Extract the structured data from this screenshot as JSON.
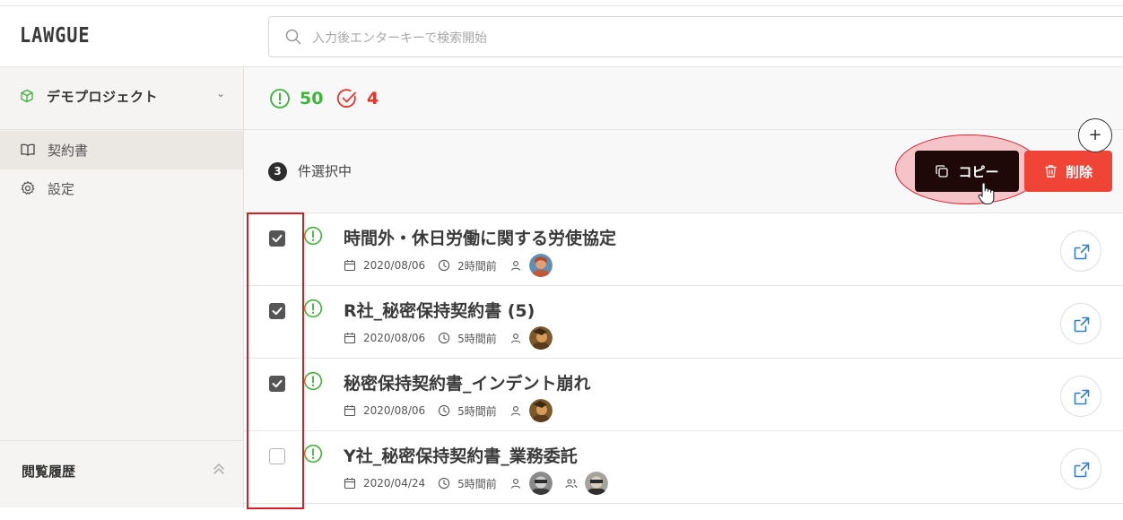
{
  "header": {
    "logo": "LAWGUE",
    "search": {
      "placeholder": "入力後エンターキーで検索開始",
      "icon": "search-icon"
    }
  },
  "sidebar": {
    "project": {
      "name": "デモプロジェクト",
      "icon": "cube-icon",
      "chevron": "⌄"
    },
    "items": [
      {
        "label": "契約書",
        "icon": "book-icon",
        "active": true
      },
      {
        "label": "設定",
        "icon": "gear-icon",
        "active": false
      }
    ],
    "history": {
      "label": "閲覧履歴",
      "icon": "chevron-double-up-icon"
    }
  },
  "main": {
    "stats": [
      {
        "value": "50",
        "icon": "exclamation-circle-icon",
        "color": "#3fb33a"
      },
      {
        "value": "4",
        "icon": "check-circle-icon",
        "color": "#e8332b"
      }
    ],
    "selection": {
      "count": "3",
      "label": "件選択中",
      "copy_label": "コピー",
      "delete_label": "削除",
      "add_label": "+"
    },
    "documents": [
      {
        "title": "時間外・休日労働に関する労使協定",
        "date": "2020/08/06",
        "updated": "2時間前",
        "checked": true,
        "avatars": 1
      },
      {
        "title": "R社_秘密保持契約書 (5)",
        "date": "2020/08/06",
        "updated": "5時間前",
        "checked": true,
        "avatars": 1
      },
      {
        "title": "秘密保持契約書_インデント崩れ",
        "date": "2020/08/06",
        "updated": "5時間前",
        "checked": true,
        "avatars": 1
      },
      {
        "title": "Y社_秘密保持契約書_業務委託",
        "date": "2020/04/24",
        "updated": "5時間前",
        "checked": false,
        "avatars": 2
      }
    ]
  },
  "colors": {
    "accent_dark": "#1e0808",
    "danger": "#f04437",
    "ok_green": "#3fb33a",
    "link_blue": "#2f7fd1",
    "highlight_red": "#d71e25"
  }
}
